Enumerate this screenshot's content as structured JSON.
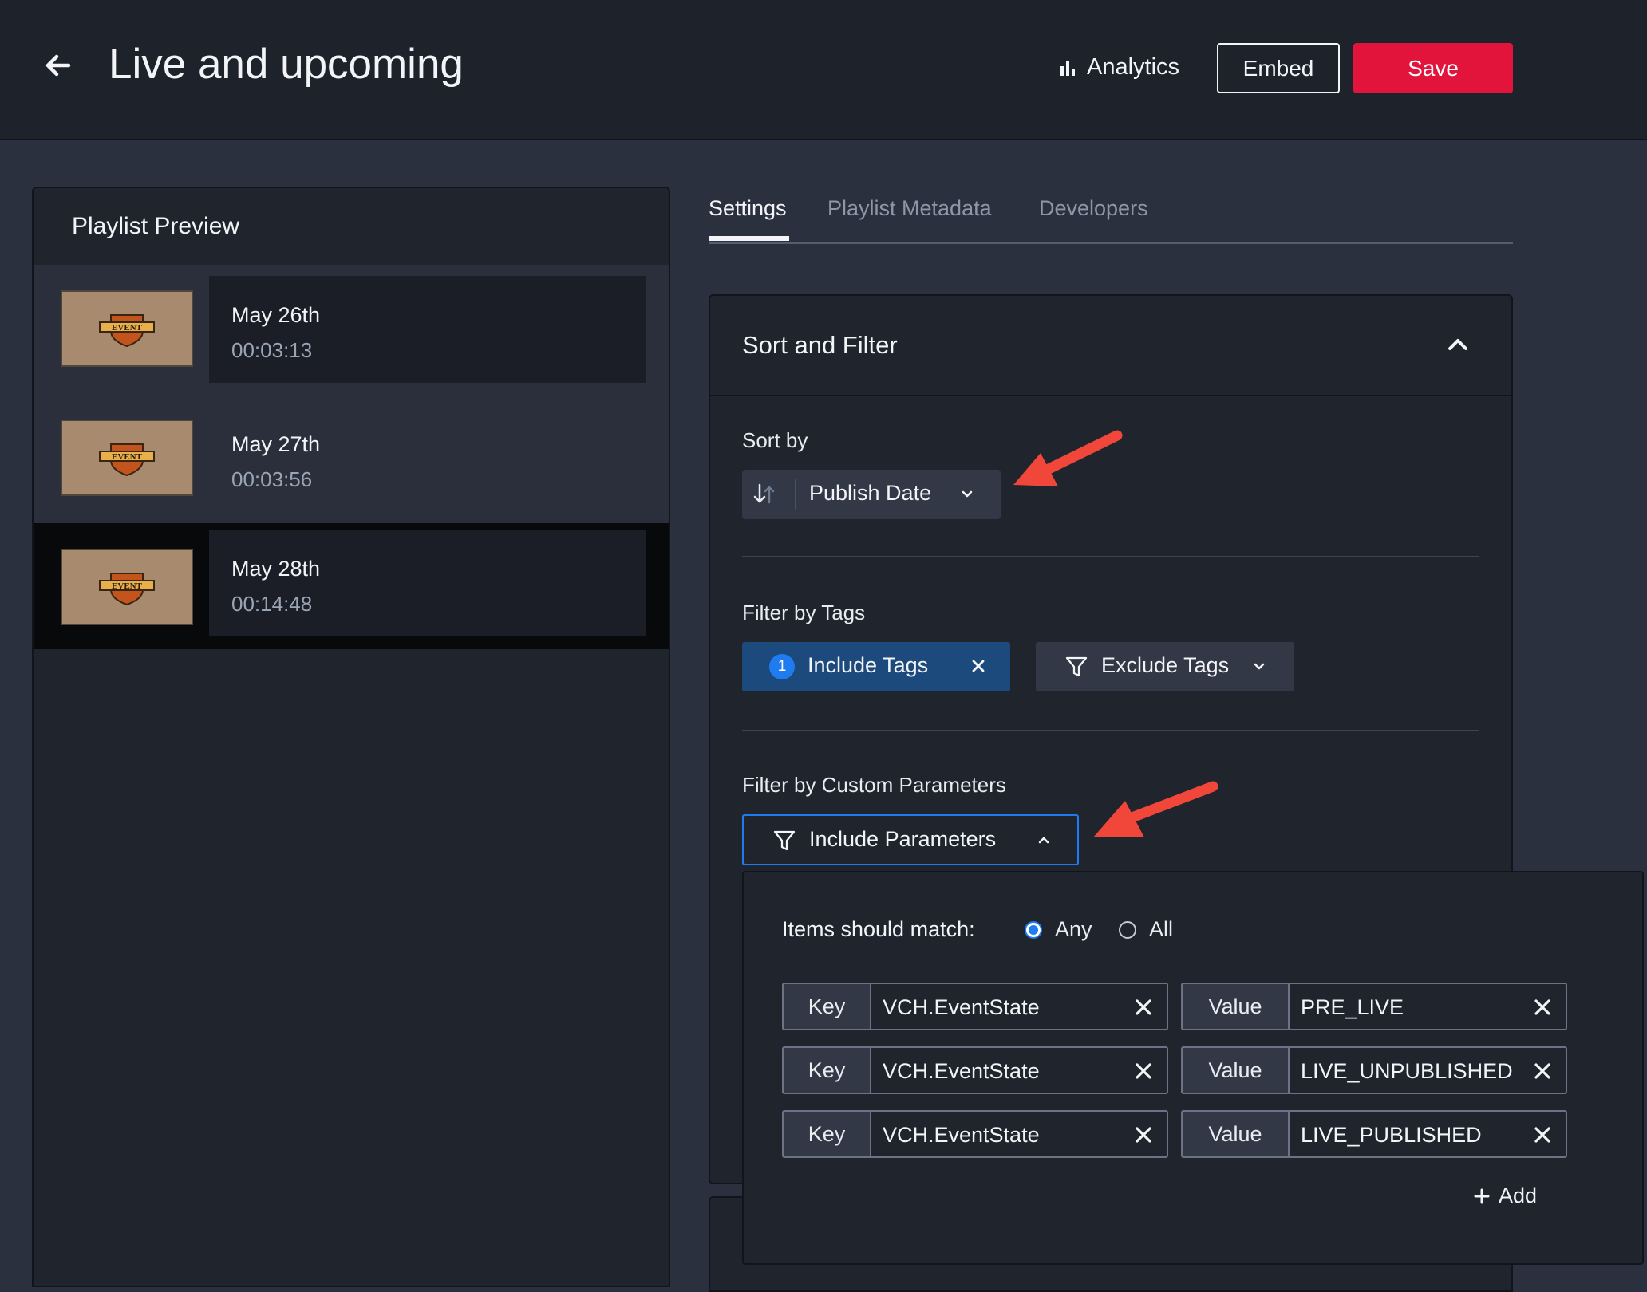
{
  "header": {
    "title": "Live and upcoming",
    "analytics_label": "Analytics",
    "embed_label": "Embed",
    "save_label": "Save"
  },
  "preview": {
    "title": "Playlist Preview",
    "items": [
      {
        "date": "May 26th",
        "duration": "00:03:13",
        "thumb_text": "EVENT"
      },
      {
        "date": "May 27th",
        "duration": "00:03:56",
        "thumb_text": "EVENT"
      },
      {
        "date": "May 28th",
        "duration": "00:14:48",
        "thumb_text": "EVENT"
      }
    ],
    "selected_index": 2
  },
  "tabs": [
    {
      "label": "Settings",
      "active": true
    },
    {
      "label": "Playlist Metadata",
      "active": false
    },
    {
      "label": "Developers",
      "active": false
    }
  ],
  "sort_filter": {
    "title": "Sort and Filter",
    "sort_label": "Sort by",
    "sort_value": "Publish Date",
    "tags_label": "Filter by Tags",
    "include_tags_count": "1",
    "include_tags_label": "Include Tags",
    "exclude_tags_label": "Exclude Tags",
    "custom_label": "Filter by Custom Parameters",
    "include_params_label": "Include Parameters"
  },
  "params_popover": {
    "match_label": "Items should match:",
    "match_options": [
      {
        "label": "Any",
        "selected": true
      },
      {
        "label": "All",
        "selected": false
      }
    ],
    "key_tag": "Key",
    "value_tag": "Value",
    "pairs": [
      {
        "key": "VCH.EventState",
        "value": "PRE_LIVE"
      },
      {
        "key": "VCH.EventState",
        "value": "LIVE_UNPUBLISHED"
      },
      {
        "key": "VCH.EventState",
        "value": "LIVE_PUBLISHED"
      }
    ],
    "add_label": "Add"
  },
  "colors": {
    "save": "#e2143c",
    "accent": "#1f7bf0",
    "annotation_arrow": "#f0473a"
  },
  "icons": [
    "back-arrow-icon",
    "bar-chart-icon",
    "sort-icon",
    "chevron-down-icon",
    "chevron-up-icon",
    "filter-icon",
    "close-icon",
    "plus-icon"
  ]
}
